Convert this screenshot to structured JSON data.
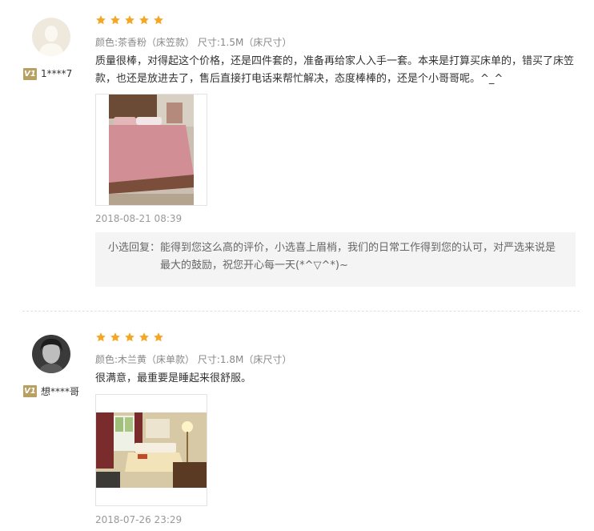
{
  "colors": {
    "star": "#f5a623",
    "vip_badge": "#b8a063",
    "reply_bg": "#f4f4f4"
  },
  "reviews": [
    {
      "username": "1****7",
      "vip_badge": "V1",
      "rating": 5,
      "spec": "颜色:茶香粉（床笠款） 尺寸:1.5M（床尺寸）",
      "comment": "质量很棒，对得起这个价格，还是四件套的，准备再给家人入手一套。本来是打算买床单的，错买了床笠款，也还是放进去了，售后直接打电话来帮忙解决，态度棒棒的，还是个小哥哥呢。^_^",
      "photo": "bedroom-photo-pink-bed",
      "date": "2018-08-21 08:39",
      "reply_label": "小选回复：",
      "reply_text": "能得到您这么高的评价，小选喜上眉梢，我们的日常工作得到您的认可，对严选来说是最大的鼓励，祝您开心每一天(*^▽^*)~"
    },
    {
      "username": "想****哥",
      "vip_badge": "V1",
      "rating": 5,
      "spec": "颜色:木兰黄（床单款） 尺寸:1.8M（床尺寸）",
      "comment": "很满意，最重要是睡起来很舒服。",
      "photo": "bedroom-photo-warm-room",
      "date": "2018-07-26 23:29"
    }
  ]
}
